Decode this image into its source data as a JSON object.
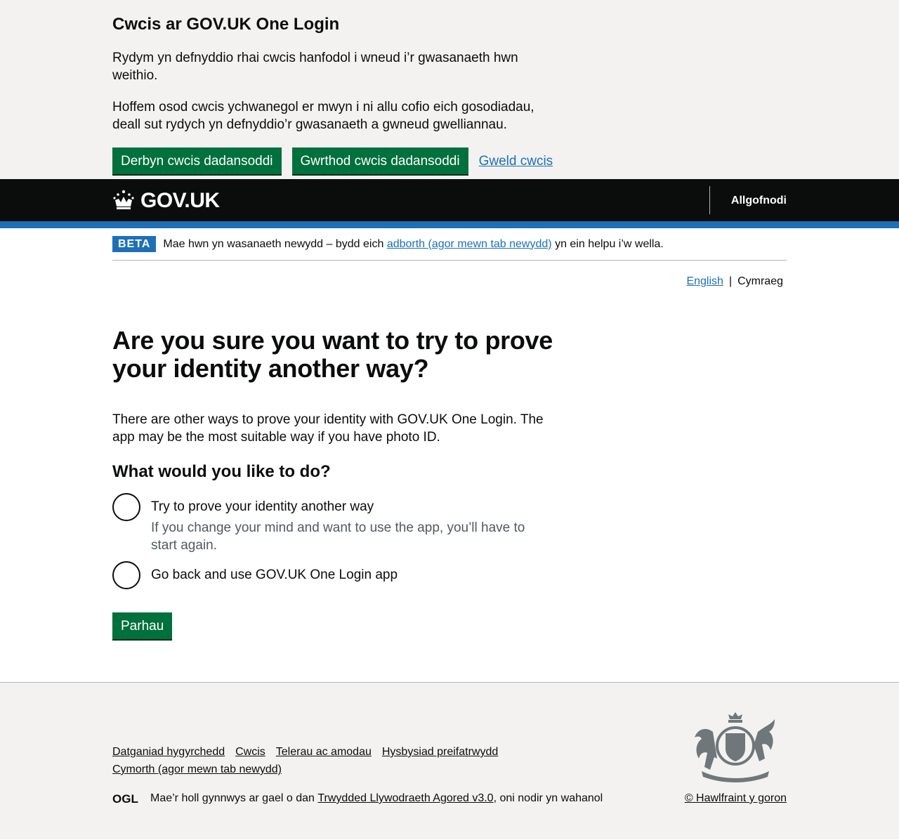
{
  "cookie_banner": {
    "title": "Cwcis ar GOV.UK One Login",
    "paragraph_1": "Rydym yn defnyddio rhai cwcis hanfodol i wneud i’r gwasanaeth hwn weithio.",
    "paragraph_2": "Hoffem osod cwcis ychwanegol er mwyn i ni allu cofio eich gosodiadau, deall sut rydych yn defnyddio’r gwasanaeth a gwneud gwelliannau.",
    "accept_label": "Derbyn cwcis dadansoddi",
    "reject_label": "Gwrthod cwcis dadansoddi",
    "view_label": "Gweld cwcis"
  },
  "header": {
    "logo_text": "GOV.UK",
    "signout_label": "Allgofnodi"
  },
  "phase_banner": {
    "tag": "BETA",
    "text_before": "Mae hwn yn wasanaeth newydd – bydd eich",
    "link_text": "adborth (agor mewn tab newydd)",
    "text_after": "yn ein helpu i’w wella."
  },
  "language": {
    "english": "English",
    "separator": "|",
    "cymraeg": "Cymraeg"
  },
  "main": {
    "heading": "Are you sure you want to try to prove your identity another way?",
    "lede": "There are other ways to prove your identity with GOV.UK One Login. The app may be the most suitable way if you have photo ID.",
    "question": "What would you like to do?",
    "options": [
      {
        "label": "Try to prove your identity another way",
        "hint": "If you change your mind and want to use the app, you’ll have to start again."
      },
      {
        "label": "Go back and use GOV.UK One Login app"
      }
    ],
    "continue_label": "Parhau"
  },
  "footer": {
    "links": [
      "Datganiad hygyrchedd",
      "Cwcis",
      "Telerau ac amodau",
      "Hysbysiad preifatrwydd",
      "Cymorth (agor mewn tab newydd)"
    ],
    "licence_before": "Mae’r holl gynnwys ar gael o dan",
    "licence_link": "Trwydded Llywodraeth Agored v3.0",
    "licence_after": ", oni nodir yn wahanol",
    "copyright": "© Hawlfraint y goron",
    "ogl_text": "OGL"
  },
  "colors": {
    "brand_green": "#00703c",
    "link_blue": "#1d70b8",
    "header_black": "#0b0c0c",
    "banner_grey": "#f3f2f1"
  }
}
